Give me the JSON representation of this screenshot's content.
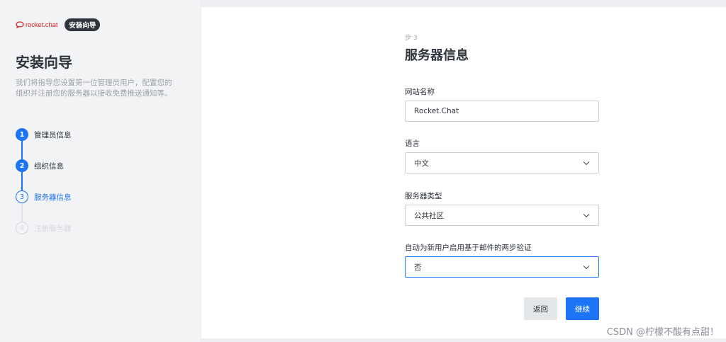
{
  "sidebar": {
    "logo_text": "rocket.chat",
    "badge": "安装向导",
    "title": "安装向导",
    "description": "我们将指导您设置第一位管理员用户，配置您的组织并注册您的服务器以接收免费推送通知等。",
    "steps": [
      {
        "number": "1",
        "label": "管理员信息",
        "state": "done"
      },
      {
        "number": "2",
        "label": "组织信息",
        "state": "done"
      },
      {
        "number": "3",
        "label": "服务器信息",
        "state": "active"
      },
      {
        "number": "4",
        "label": "注册服务器",
        "state": "pending"
      }
    ]
  },
  "form": {
    "step_caption": "步 3",
    "title": "服务器信息",
    "fields": [
      {
        "label": "网站名称",
        "value": "Rocket.Chat",
        "type": "text"
      },
      {
        "label": "语言",
        "value": "中文",
        "type": "select"
      },
      {
        "label": "服务器类型",
        "value": "公共社区",
        "type": "select"
      },
      {
        "label": "自动为新用户启用基于邮件的两步验证",
        "value": "否",
        "type": "select"
      }
    ],
    "back_label": "返回",
    "next_label": "继续"
  },
  "watermark": "CSDN @柠檬不酸有点甜！",
  "colors": {
    "accent": "#1d74f5",
    "brand": "#db2323",
    "text": "#2f343d",
    "muted": "#9ea2a8"
  }
}
